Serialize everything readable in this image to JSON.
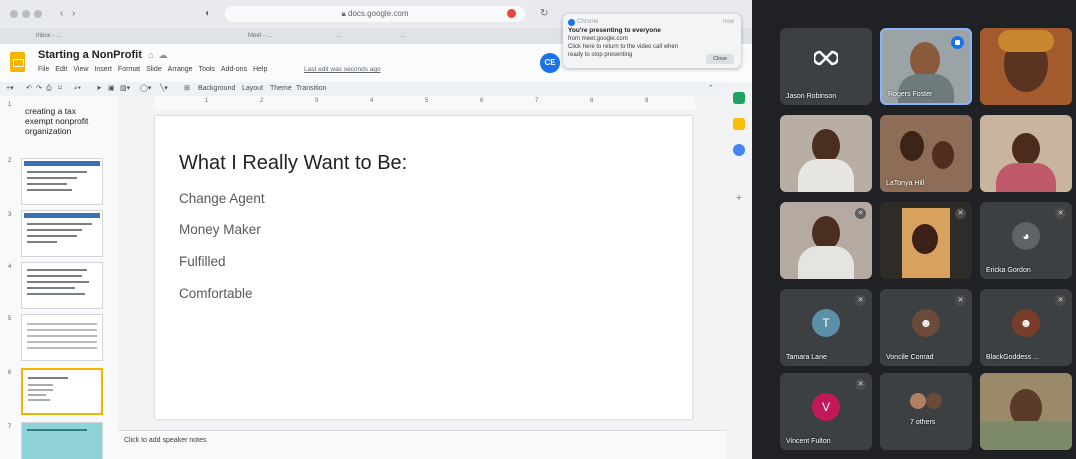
{
  "browser": {
    "url": "docs.google.com",
    "bookmarks": [
      "Inbox - …",
      "Meet - …",
      "…",
      "…"
    ]
  },
  "slides_app": {
    "doc_title": "Starting a NonProfit",
    "menu": [
      "File",
      "Edit",
      "View",
      "Insert",
      "Format",
      "Slide",
      "Arrange",
      "Tools",
      "Add-ons",
      "Help"
    ],
    "last_edit": "Last edit was seconds ago",
    "present_badge": "CE",
    "toolbar": {
      "background": "Background",
      "layout": "Layout",
      "theme": "Theme",
      "transition": "Transition"
    },
    "ruler_numbers": [
      "1",
      "2",
      "3",
      "4",
      "5",
      "6",
      "7",
      "8",
      "9"
    ],
    "filmstrip": [
      {
        "num": "1",
        "text": "creating a tax exempt nonprofit organization"
      },
      {
        "num": "2",
        "text": ""
      },
      {
        "num": "3",
        "text": ""
      },
      {
        "num": "4",
        "text": ""
      },
      {
        "num": "5",
        "text": ""
      },
      {
        "num": "6",
        "text": ""
      },
      {
        "num": "7",
        "text": ""
      }
    ],
    "slide": {
      "title": "What I Really Want to Be:",
      "bullets": [
        "Change Agent",
        "Money Maker",
        "Fulfilled",
        "Comfortable"
      ]
    },
    "speaker_notes_placeholder": "Click to add speaker notes"
  },
  "toast": {
    "app": "Chrome",
    "time": "now",
    "title": "You're presenting to everyone",
    "lines": [
      "from meet.google.com",
      "Click here to return to the video call when",
      "ready to stop presenting"
    ],
    "button": "Close"
  },
  "meet": {
    "tiles": [
      {
        "name": "Jason Robinson",
        "type": "logo"
      },
      {
        "name": "Rogers Foster",
        "type": "video",
        "speaking": true
      },
      {
        "name": "",
        "type": "video"
      },
      {
        "name": "",
        "type": "video"
      },
      {
        "name": "LaTonya Hill",
        "type": "video"
      },
      {
        "name": "",
        "type": "video"
      },
      {
        "name": "",
        "type": "video",
        "muted": true
      },
      {
        "name": "",
        "type": "video",
        "muted": true
      },
      {
        "name": "Ericka Gordon",
        "type": "avatar",
        "muted": true
      },
      {
        "name": "Tamara Lane",
        "type": "letter",
        "letter": "T",
        "color": "#5b8fa8",
        "muted": true
      },
      {
        "name": "Voncile Conrad",
        "type": "avatar",
        "muted": true
      },
      {
        "name": "BlackGoddess ...",
        "type": "avatar",
        "muted": true
      },
      {
        "name": "Vincent Fulton",
        "type": "letter",
        "letter": "V",
        "color": "#c2185b",
        "muted": true
      },
      {
        "name": "7 others",
        "type": "group"
      },
      {
        "name": "",
        "type": "video"
      }
    ]
  }
}
